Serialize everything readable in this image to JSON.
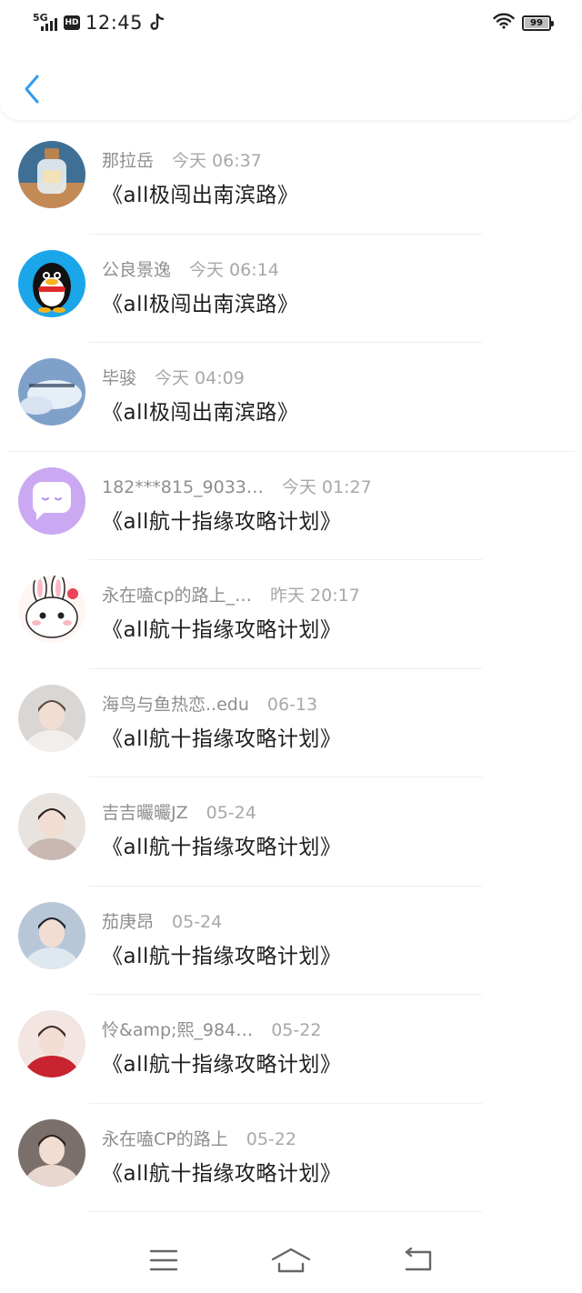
{
  "status_bar": {
    "network": "5G",
    "hd": "HD",
    "time": "12:45",
    "battery": "99",
    "battery_level": 0.99
  },
  "header": {
    "back_icon": "chevron-left-icon",
    "accent_color": "#2e9bf0"
  },
  "items": [
    {
      "name": "那拉岳",
      "time": "今天 06:37",
      "title": "《all极闯出南滨路》",
      "avatar": "bottle-avatar"
    },
    {
      "name": "公良景逸",
      "time": "今天 06:14",
      "title": "《all极闯出南滨路》",
      "avatar": "penguin-avatar"
    },
    {
      "name": "毕骏",
      "time": "今天 04:09",
      "title": "《all极闯出南滨路》",
      "avatar": "sky-avatar"
    },
    {
      "name": "182***815_9033…",
      "time": "今天 01:27",
      "title": "《all航十指缘攻略计划》",
      "avatar": "chat-bubble-avatar"
    },
    {
      "name": "永在嗑cp的路上_…",
      "time": "昨天 20:17",
      "title": "《all航十指缘攻略计划》",
      "avatar": "bunny-avatar"
    },
    {
      "name": "海鸟与鱼热恋..edu",
      "time": "06-13",
      "title": "《all航十指缘攻略计划》",
      "avatar": "photo-avatar"
    },
    {
      "name": "吉吉曮曮JZ",
      "time": "05-24",
      "title": "《all航十指缘攻略计划》",
      "avatar": "photo-avatar"
    },
    {
      "name": "茄庚昂",
      "time": "05-24",
      "title": "《all航十指缘攻略计划》",
      "avatar": "photo-avatar"
    },
    {
      "name": "怜&amp;熙_984…",
      "time": "05-22",
      "title": "《all航十指缘攻略计划》",
      "avatar": "photo-avatar"
    },
    {
      "name": "永在嗑CP的路上",
      "time": "05-22",
      "title": "《all航十指缘攻略计划》",
      "avatar": "photo-avatar"
    }
  ],
  "nav": {
    "menu_icon": "menu-icon",
    "home_icon": "home-icon",
    "back_icon": "back-icon"
  }
}
